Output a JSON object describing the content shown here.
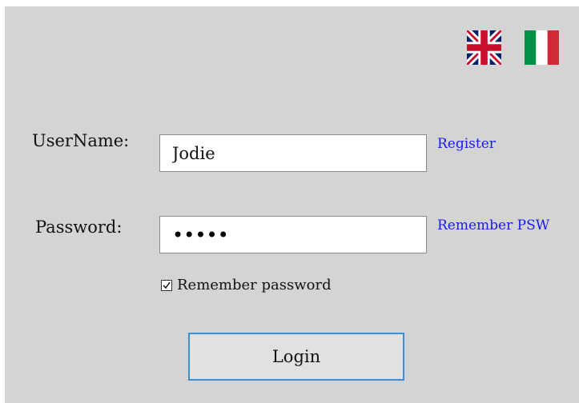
{
  "languages": [
    {
      "name": "English",
      "icon": "uk-flag-icon"
    },
    {
      "name": "Italian",
      "icon": "italy-flag-icon"
    }
  ],
  "form": {
    "username_label": "UserName:",
    "username_value": "Jodie",
    "password_label": "Password:",
    "password_value": "12345",
    "register_link": "Register",
    "remember_psw_link": "Remember PSW",
    "remember_checkbox_label": "Remember password",
    "remember_checked": true,
    "login_button": "Login"
  },
  "colors": {
    "panel_background": "#d4d4d4",
    "link": "#1a1aee",
    "button_border_focus": "#3d8fd4",
    "button_background": "#e1e1e1"
  }
}
